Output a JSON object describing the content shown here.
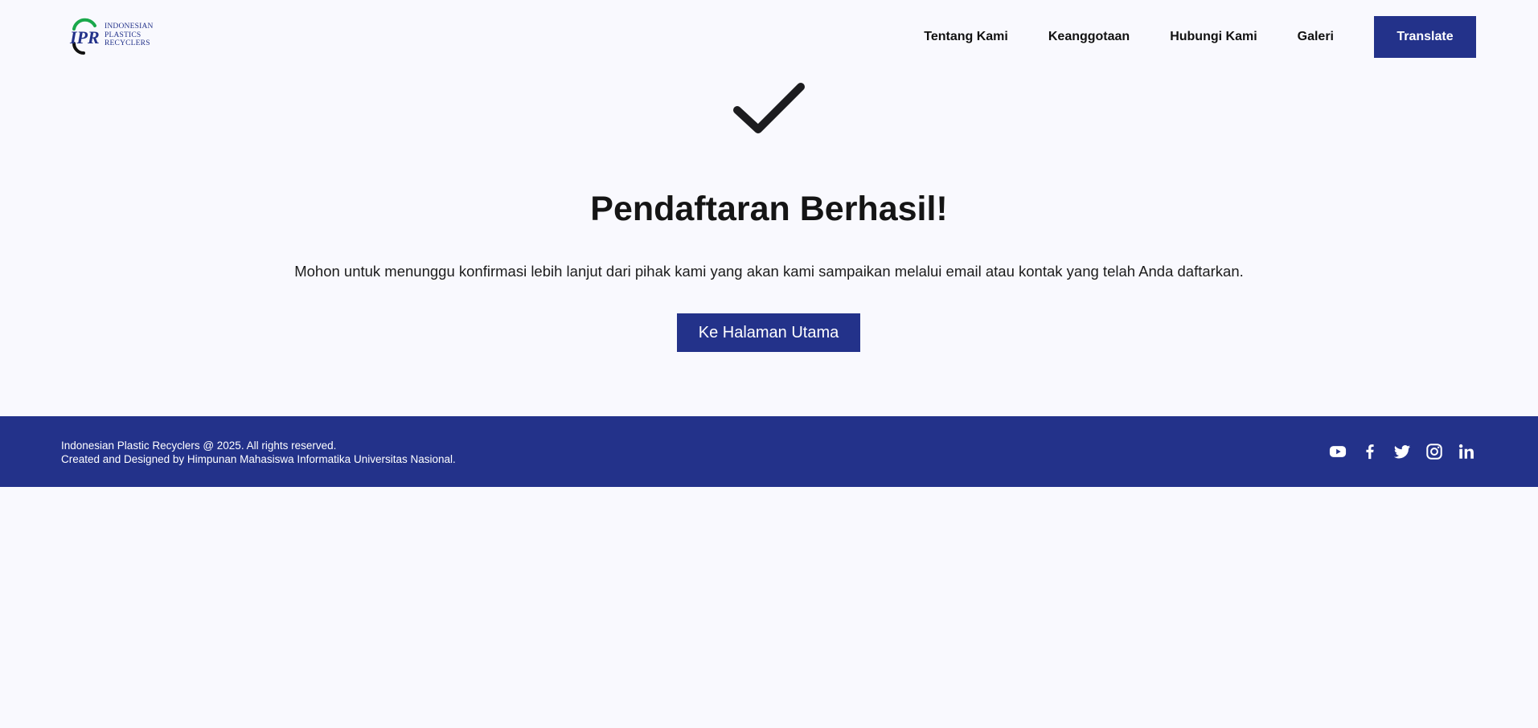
{
  "header": {
    "logo": {
      "mark": "IPR",
      "lines": [
        "INDONESIAN",
        "PLASTICS",
        "RECYCLERS"
      ]
    },
    "nav": [
      {
        "label": "Tentang Kami"
      },
      {
        "label": "Keanggotaan"
      },
      {
        "label": "Hubungi Kami"
      },
      {
        "label": "Galeri"
      }
    ],
    "translate_label": "Translate"
  },
  "main": {
    "icon": "checkmark-icon",
    "title": "Pendaftaran Berhasil!",
    "message": "Mohon untuk menunggu konfirmasi lebih lanjut dari pihak kami yang akan kami sampaikan melalui email atau kontak yang telah Anda daftarkan.",
    "button_label": "Ke Halaman Utama"
  },
  "footer": {
    "copyright": "Indonesian Plastic Recyclers @ 2025. All rights reserved.",
    "credit": "Created and Designed by Himpunan Mahasiswa Informatika Universitas Nasional.",
    "socials": [
      "youtube-icon",
      "facebook-icon",
      "twitter-icon",
      "instagram-icon",
      "linkedin-icon"
    ]
  },
  "colors": {
    "brand": "#23328a",
    "background": "#f9f9fe",
    "logo_green": "#1aa84b"
  }
}
